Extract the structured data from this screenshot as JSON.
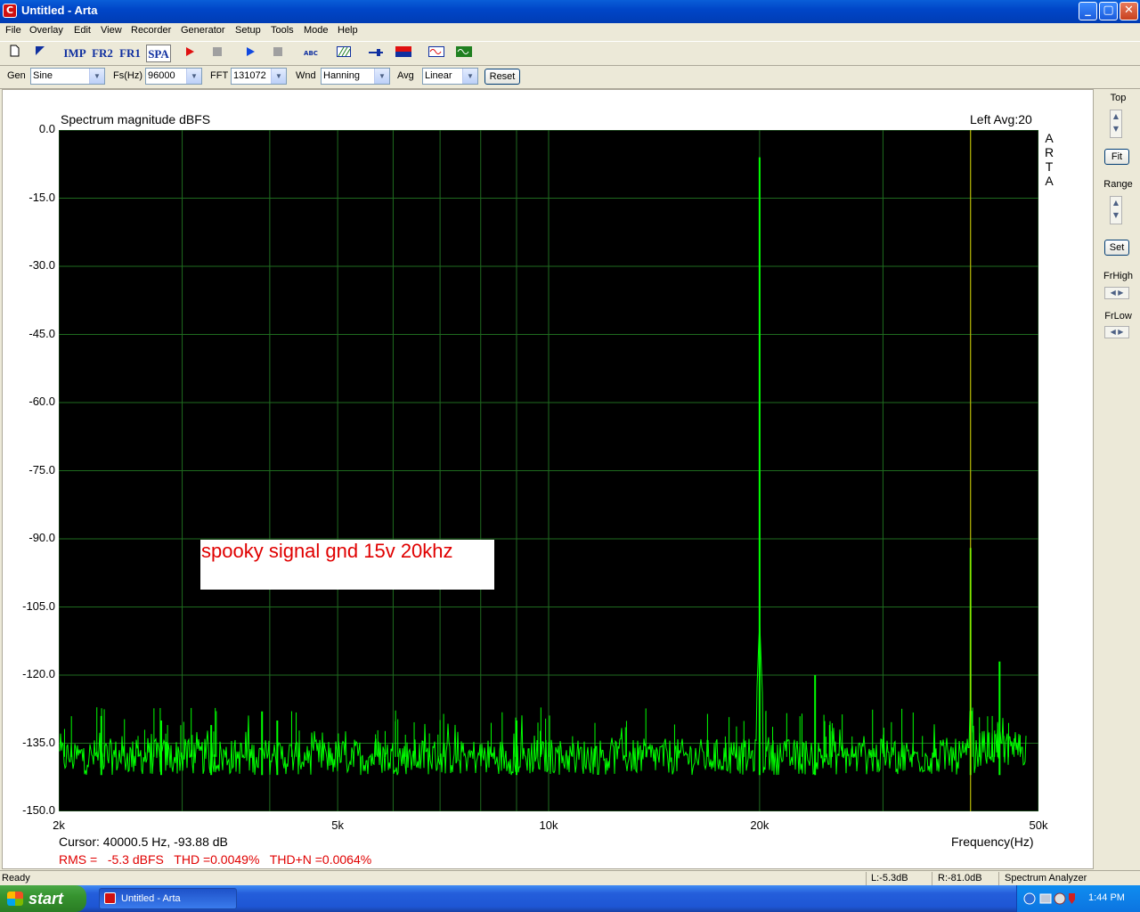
{
  "window": {
    "title": "Untitled - Arta",
    "minimize": "_",
    "maximize": "▢",
    "close": "✕"
  },
  "menu": [
    "File",
    "Overlay",
    "Edit",
    "View",
    "Recorder",
    "Generator",
    "Setup",
    "Tools",
    "Mode",
    "Help"
  ],
  "toolbar": {
    "imp": "IMP",
    "fr2": "FR2",
    "fr1": "FR1",
    "spa": "SPA",
    "abc": "ABC"
  },
  "settings": {
    "gen_label": "Gen",
    "gen_value": "Sine",
    "fs_label": "Fs(Hz)",
    "fs_value": "96000",
    "fft_label": "FFT",
    "fft_value": "131072",
    "wnd_label": "Wnd",
    "wnd_value": "Hanning",
    "avg_label": "Avg",
    "avg_value": "Linear",
    "reset": "Reset"
  },
  "side": {
    "top": "Top",
    "fit": "Fit",
    "range": "Range",
    "set": "Set",
    "frhigh": "FrHigh",
    "frlow": "FrLow"
  },
  "plot_header": {
    "left": "Spectrum magnitude dBFS",
    "right": "Left  Avg:20",
    "brand": [
      "A",
      "R",
      "T",
      "A"
    ]
  },
  "annotation": "spooky signal gnd 15v 20khz",
  "cursor_text": "Cursor: 40000.5 Hz, -93.88 dB",
  "measure_text": "RMS =   -5.3 dBFS   THD =0.0049%   THD+N =0.0064%",
  "xlabel": "Frequency(Hz)",
  "status": {
    "ready": "Ready",
    "left": "L:-5.3dB",
    "right": "R:-81.0dB",
    "mode": "Spectrum Analyzer"
  },
  "taskbar": {
    "start": "start",
    "task": "Untitled - Arta",
    "clock": "1:44 PM"
  },
  "colors": {
    "trace": "#00ff00",
    "grid": "#1f6b1f",
    "cursor": "#d8c800",
    "plot_bg": "#000000",
    "annotation": "#e00000"
  },
  "chart_data": {
    "type": "line",
    "x_scale": "log",
    "xlim": [
      2000,
      50000
    ],
    "ylim": [
      -150,
      0
    ],
    "yticks": [
      0.0,
      -15.0,
      -30.0,
      -45.0,
      -60.0,
      -75.0,
      -90.0,
      -105.0,
      -120.0,
      -135.0,
      -150.0
    ],
    "ytick_labels": [
      "0.0",
      "-15.0",
      "-30.0",
      "-45.0",
      "-60.0",
      "-75.0",
      "-90.0",
      "-105.0",
      "-120.0",
      "-135.0",
      "-150.0"
    ],
    "xticks": [
      2000,
      5000,
      10000,
      20000,
      50000
    ],
    "xtick_labels": [
      "2k",
      "5k",
      "10k",
      "20k",
      "50k"
    ],
    "grid": true,
    "noise_floor_db": -138,
    "cursor_x": 40000.5,
    "peaks": [
      {
        "x": 20000,
        "y": -6
      },
      {
        "x": 40000,
        "y": -92
      },
      {
        "x": 24000,
        "y": -120
      },
      {
        "x": 44000,
        "y": -117
      },
      {
        "x": 2300,
        "y": -129
      },
      {
        "x": 3900,
        "y": -128
      },
      {
        "x": 9000,
        "y": -130
      },
      {
        "x": 2800,
        "y": -130
      },
      {
        "x": 3300,
        "y": -131
      },
      {
        "x": 4100,
        "y": -130
      }
    ]
  }
}
